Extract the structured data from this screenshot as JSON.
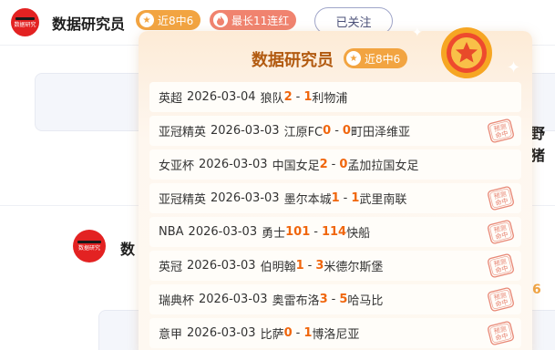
{
  "header": {
    "name": "数据研究员",
    "avatar_text": "数据研究",
    "streak_badge": "近8中6",
    "max_badge": "最长11连红",
    "follow_label": "已关注"
  },
  "background": {
    "right_text": "野猪",
    "user_name": "数",
    "right_number": "6"
  },
  "popup": {
    "title": "数据研究员",
    "badge": "近8中6",
    "stamp_text": "预测命中",
    "matches": [
      {
        "league": "英超",
        "date": "2026-03-04",
        "home": "狼队",
        "home_score": "2",
        "away_score": "1",
        "away": "利物浦",
        "hit": false
      },
      {
        "league": "亚冠精英",
        "date": "2026-03-03",
        "home": "江原FC",
        "home_score": "0",
        "away_score": "0",
        "away": "町田泽维亚",
        "hit": true
      },
      {
        "league": "女亚杯",
        "date": "2026-03-03",
        "home": "中国女足",
        "home_score": "2",
        "away_score": "0",
        "away": "孟加拉国女足",
        "hit": false
      },
      {
        "league": "亚冠精英",
        "date": "2026-03-03",
        "home": "墨尔本城",
        "home_score": "1",
        "away_score": "1",
        "away": "武里南联",
        "hit": true
      },
      {
        "league": "NBA",
        "date": "2026-03-03",
        "home": "勇士",
        "home_score": "101",
        "away_score": "114",
        "away": "快船",
        "hit": true
      },
      {
        "league": "英冠",
        "date": "2026-03-03",
        "home": "伯明翰",
        "home_score": "1",
        "away_score": "3",
        "away": "米德尔斯堡",
        "hit": true
      },
      {
        "league": "瑞典杯",
        "date": "2026-03-03",
        "home": "奥雷布洛",
        "home_score": "3",
        "away_score": "5",
        "away": "哈马比",
        "hit": true
      },
      {
        "league": "意甲",
        "date": "2026-03-03",
        "home": "比萨",
        "home_score": "0",
        "away_score": "1",
        "away": "博洛尼亚",
        "hit": true
      }
    ]
  },
  "colors": {
    "score": "#f0660d",
    "streak": "#f2a441",
    "max": "#f0836f",
    "stamp": "#e0604a"
  },
  "icons": {
    "star": "star-icon",
    "flame": "flame-icon",
    "medal": "medal-icon",
    "stamp": "hit-stamp-icon"
  }
}
